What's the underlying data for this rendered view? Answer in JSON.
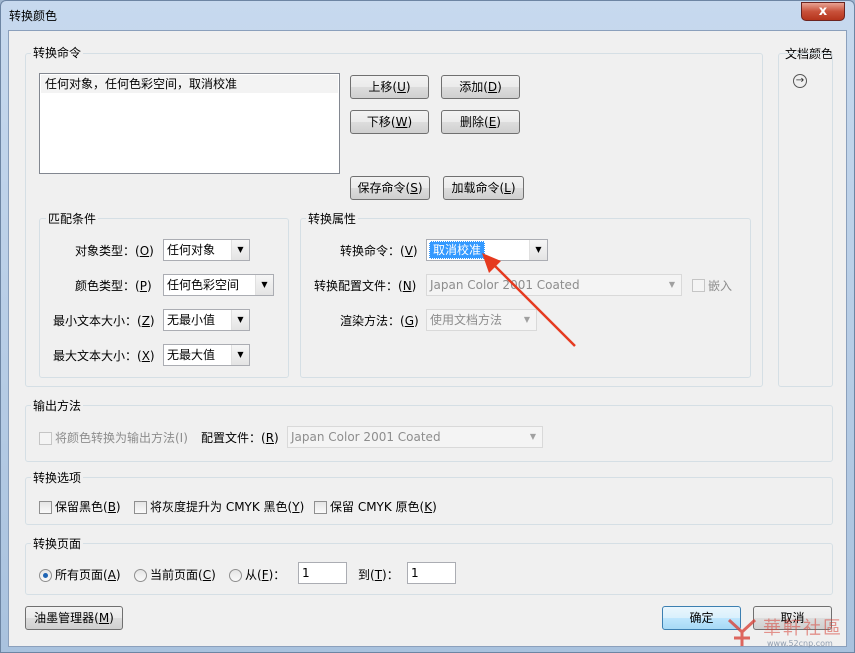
{
  "window": {
    "title": "转换颜色",
    "close_glyph": "x"
  },
  "right_panel": {
    "title": "文档颜色",
    "arrow_icon": "arrow-right-circle-icon"
  },
  "commands": {
    "group_label": "转换命令",
    "list_items": [
      "任何对象，任何色彩空间，取消校准"
    ],
    "move_up": {
      "text": "上移(",
      "key": "U",
      "end": ")"
    },
    "move_down": {
      "text": "下移(",
      "key": "W",
      "end": ")"
    },
    "add": {
      "text": "添加(",
      "key": "D",
      "end": ")"
    },
    "delete": {
      "text": "删除(",
      "key": "E",
      "end": ")"
    },
    "save": {
      "text": "保存命令(",
      "key": "S",
      "end": ")"
    },
    "load": {
      "text": "加载命令(",
      "key": "L",
      "end": ")"
    }
  },
  "match": {
    "group_label": "匹配条件",
    "object_type": {
      "label": "对象类型：(",
      "key": "O",
      "end": ")",
      "value": "任何对象"
    },
    "color_type": {
      "label": "颜色类型：(",
      "key": "P",
      "end": ")",
      "value": "任何色彩空间"
    },
    "min_text": {
      "label": "最小文本大小：(",
      "key": "Z",
      "end": ")",
      "value": "无最小值"
    },
    "max_text": {
      "label": "最大文本大小：(",
      "key": "X",
      "end": ")",
      "value": "无最大值"
    }
  },
  "attributes": {
    "group_label": "转换属性",
    "command": {
      "label": "转换命令：(",
      "key": "V",
      "end": ")",
      "value": "取消校准"
    },
    "profile": {
      "label": "转换配置文件：(",
      "key": "N",
      "end": ")",
      "value": "Japan Color 2001 Coated"
    },
    "embed": "嵌入",
    "render": {
      "label": "渲染方法：(",
      "key": "G",
      "end": ")",
      "value": "使用文档方法"
    }
  },
  "output": {
    "group_label": "输出方法",
    "convert_checkbox": "将颜色转换为输出方法(I)",
    "profile": {
      "label": "配置文件：(",
      "key": "R",
      "end": ")",
      "value": "Japan Color 2001 Coated"
    }
  },
  "options": {
    "group_label": "转换选项",
    "keep_black": {
      "text": "保留黑色(",
      "key": "B",
      "end": ")"
    },
    "gray_cmyk": {
      "text": "将灰度提升为 CMYK 黑色(",
      "key": "Y",
      "end": ")"
    },
    "keep_cmyk": {
      "text": "保留 CMYK 原色(",
      "key": "K",
      "end": ")"
    }
  },
  "pages": {
    "group_label": "转换页面",
    "all": {
      "text": "所有页面(",
      "key": "A",
      "end": ")",
      "selected": true
    },
    "current": {
      "text": "当前页面(",
      "key": "C",
      "end": ")"
    },
    "from": {
      "text": "从(",
      "key": "F",
      "end": ")：",
      "value": "1"
    },
    "to": {
      "text": "到(",
      "key": "T",
      "end": ")：",
      "value": "1"
    }
  },
  "footer": {
    "ink": {
      "text": "油墨管理器(",
      "key": "M",
      "end": ")"
    },
    "ok": "确定",
    "cancel": "取消"
  },
  "watermark": {
    "brand": "華軒社區",
    "url": "www.52cnp.com"
  },
  "colors": {
    "accent": "#3399ff",
    "arrow": "#e53a1f",
    "close": "#c8513a"
  }
}
